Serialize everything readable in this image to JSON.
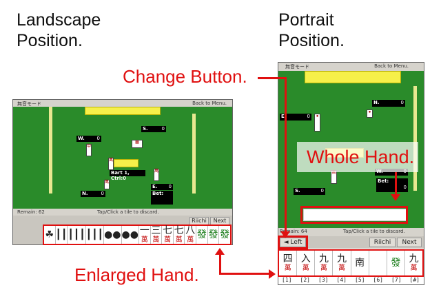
{
  "headings": {
    "landscape_line1": "Landscape",
    "landscape_line2": "Position.",
    "portrait_line1": "Portrait",
    "portrait_line2": "Position."
  },
  "callouts": {
    "change_button": "Change Button.",
    "whole_hand": "Whole Hand.",
    "enlarged_hand": "Enlarged Hand."
  },
  "landscape": {
    "mode_label": "無音モード",
    "back_label": "Back to Menu.",
    "players": [
      {
        "seat": "S.",
        "points": "0"
      },
      {
        "seat": "W.",
        "points": "0"
      },
      {
        "seat": "N.",
        "points": "0"
      },
      {
        "seat": "E.",
        "points": "0"
      }
    ],
    "bet_label": "Bet:",
    "center_info": "Bart 1, Ctrl:0",
    "remain": "Remain: 62",
    "instruction": "Tap/Click a tile to discard.",
    "riichi": "Riichi",
    "next": "Next",
    "hand": [
      {
        "top": "☘",
        "kan": ""
      },
      {
        "top": "┃┃",
        "kan": ""
      },
      {
        "top": "┃┃┃",
        "kan": ""
      },
      {
        "top": "┃┃┃",
        "kan": ""
      },
      {
        "top": "●●",
        "kan": ""
      },
      {
        "top": "●●",
        "kan": ""
      },
      {
        "top": "一",
        "kan": "萬"
      },
      {
        "top": "三",
        "kan": "萬"
      },
      {
        "top": "七",
        "kan": "萬"
      },
      {
        "top": "七",
        "kan": "萬"
      },
      {
        "top": "八",
        "kan": "萬"
      },
      {
        "top": "發",
        "kan": ""
      },
      {
        "top": "發",
        "kan": ""
      },
      {
        "top": "發",
        "kan": ""
      }
    ]
  },
  "portrait": {
    "mode_label": "無音モード",
    "back_label": "Back to Menu.",
    "players": [
      {
        "seat": "E.",
        "points": "0"
      },
      {
        "seat": "N.",
        "points": "0"
      },
      {
        "seat": "W.",
        "points": "0"
      },
      {
        "seat": "S.",
        "points": "0"
      }
    ],
    "bet_label": "Bet:",
    "bet_value": "0",
    "remain": "Remain: 64",
    "instruction": "Tap/Click a tile to discard.",
    "left_button": "◄ Left",
    "riichi": "Riichi",
    "next": "Next",
    "hand": [
      {
        "top": "四",
        "kan": "萬"
      },
      {
        "top": "入",
        "kan": "萬"
      },
      {
        "top": "九",
        "kan": "萬"
      },
      {
        "top": "九",
        "kan": "萬"
      },
      {
        "top": "南",
        "kan": ""
      },
      {
        "top": "",
        "kan": ""
      },
      {
        "top": "發",
        "kan": ""
      },
      {
        "top": "九",
        "kan": "萬"
      }
    ],
    "tile_numbers": [
      "[1]",
      "[2]",
      "[3]",
      "[4]",
      "[5]",
      "[6]",
      "[7]",
      "[#]"
    ]
  },
  "colors": {
    "table_green": "#2a8b2a",
    "annotation_red": "#e01010",
    "tile_strip_yellow": "#f6f04a"
  }
}
